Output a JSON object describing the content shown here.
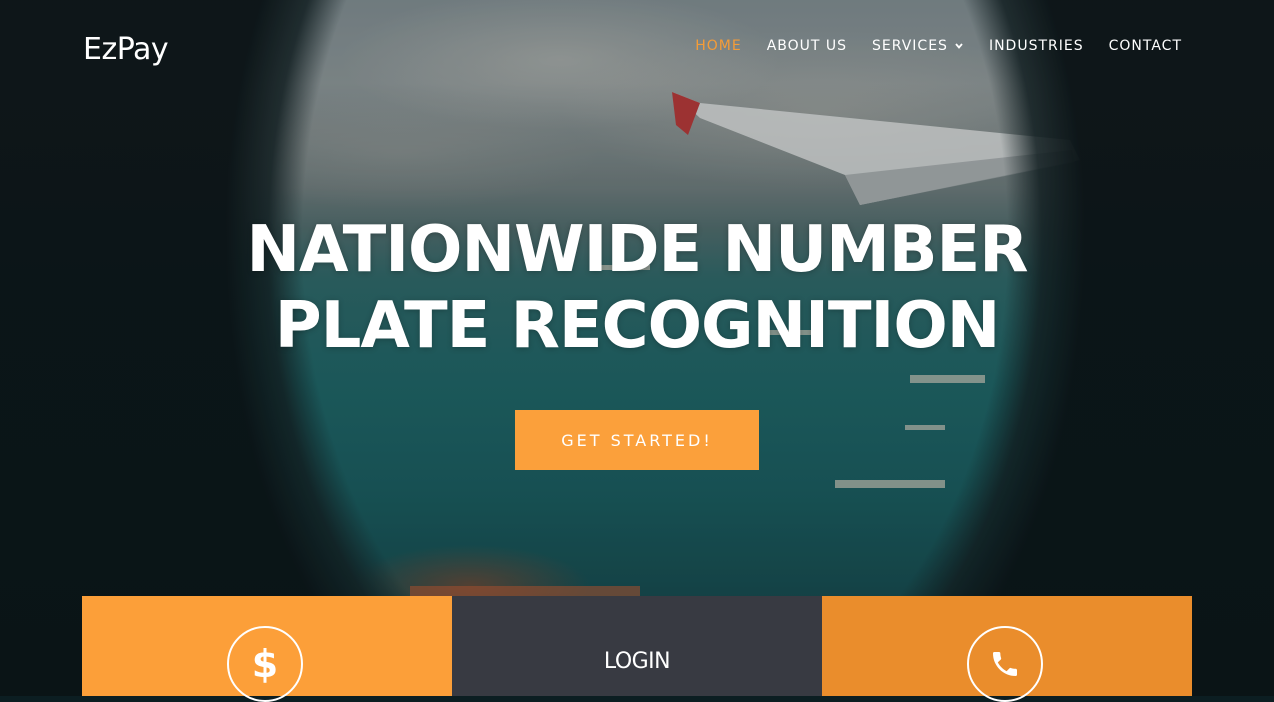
{
  "header": {
    "logo": "EzPay",
    "nav": [
      {
        "label": "HOME",
        "active": true
      },
      {
        "label": "ABOUT US"
      },
      {
        "label": "SERVICES",
        "has_dropdown": true
      },
      {
        "label": "INDUSTRIES"
      },
      {
        "label": "CONTACT"
      }
    ]
  },
  "hero": {
    "headline_line1": "NATIONWIDE NUMBER",
    "headline_line2": "PLATE RECOGNITION",
    "cta_label": "GET STARTED!"
  },
  "cards": [
    {
      "icon": "dollar-icon",
      "color": "#fc9f39"
    },
    {
      "title": "LOGIN",
      "color": "#383a42"
    },
    {
      "icon": "phone-icon",
      "color": "#ea8d2c"
    }
  ],
  "colors": {
    "accent": "#fba03b",
    "nav_active": "#f49c38",
    "text": "#ffffff"
  }
}
